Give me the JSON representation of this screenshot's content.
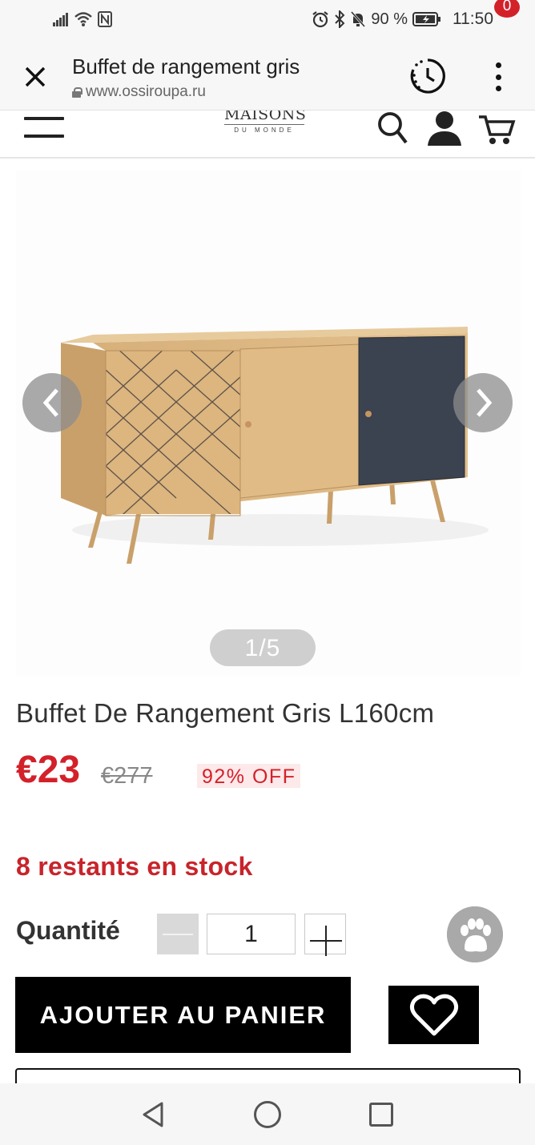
{
  "status_bar": {
    "battery": "90 %",
    "time": "11:50"
  },
  "browser": {
    "page_title": "Buffet de rangement gris",
    "url": "www.ossiroupa.ru"
  },
  "site_header": {
    "logo_top": "MAISONS",
    "logo_bottom": "DU MONDE",
    "cart_count": "0"
  },
  "gallery": {
    "counter": "1/5"
  },
  "product": {
    "title": "Buffet De Rangement Gris L160cm",
    "price": "€23",
    "old_price": "€277",
    "discount": "92% OFF",
    "stock": "8 restants en stock",
    "quantity_label": "Quantité",
    "quantity_value": "1",
    "add_to_cart": "AJOUTER AU PANIER"
  },
  "colors": {
    "accent_red": "#d3212a",
    "button_black": "#000000",
    "wood": "#d9b27c",
    "navy_door": "#3b4250"
  },
  "icons": [
    "close-icon",
    "lock-icon",
    "history-icon",
    "more-vert-icon",
    "hamburger-icon",
    "search-icon",
    "user-icon",
    "cart-icon",
    "chevron-left-icon",
    "chevron-right-icon",
    "paw-icon",
    "heart-icon",
    "back-icon",
    "home-icon",
    "recents-icon"
  ]
}
